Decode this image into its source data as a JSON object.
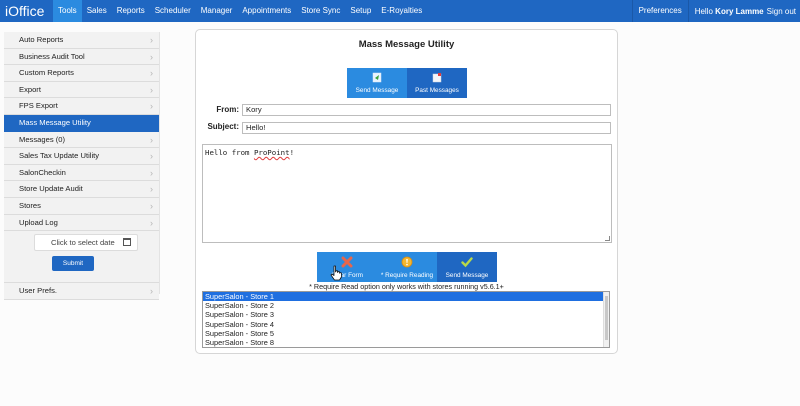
{
  "app": {
    "logo": "iOffice"
  },
  "nav": {
    "items": [
      "Tools",
      "Sales",
      "Reports",
      "Scheduler",
      "Manager",
      "Appointments",
      "Store Sync",
      "Setup",
      "E-Royalties"
    ],
    "active": "Tools"
  },
  "topright": {
    "preferences": "Preferences",
    "hello_prefix": "Hello",
    "user": "Kory Lamme",
    "signout": "Sign out"
  },
  "sidebar": {
    "items": [
      {
        "label": "Auto Reports",
        "active": false
      },
      {
        "label": "Business Audit Tool",
        "active": false
      },
      {
        "label": "Custom Reports",
        "active": false
      },
      {
        "label": "Export",
        "active": false
      },
      {
        "label": "FPS Export",
        "active": false
      },
      {
        "label": "Mass Message Utility",
        "active": true
      },
      {
        "label": "Messages (0)",
        "active": false
      },
      {
        "label": "Sales Tax Update Utility",
        "active": false
      },
      {
        "label": "SalonCheckin",
        "active": false
      },
      {
        "label": "Store Update Audit",
        "active": false
      },
      {
        "label": "Stores",
        "active": false
      },
      {
        "label": "Upload Log",
        "active": false
      }
    ],
    "date_placeholder": "Click to select date",
    "submit": "Submit",
    "user_prefs": "User Prefs."
  },
  "panel": {
    "title": "Mass Message Utility",
    "tabs": {
      "send": "Send Message",
      "past": "Past Messages"
    },
    "from_label": "From:",
    "from_value": "Kory",
    "subject_label": "Subject:",
    "subject_value": "Hello!",
    "message_prefix": "Hello from ",
    "message_word": "ProPoint",
    "message_suffix": "!",
    "actions": {
      "clear": "Clear Form",
      "require": "* Require Reading",
      "send": "Send Message"
    },
    "note": "* Require Read option only works with stores running v5.6.1+",
    "stores": [
      "SuperSalon - Store 1",
      "SuperSalon - Store 2",
      "SuperSalon - Store 3",
      "SuperSalon - Store 4",
      "SuperSalon - Store 5",
      "SuperSalon - Store 8"
    ]
  },
  "colors": {
    "brand": "#1f67c2",
    "accent": "#2b8be0",
    "selected": "#1f6fe0"
  }
}
